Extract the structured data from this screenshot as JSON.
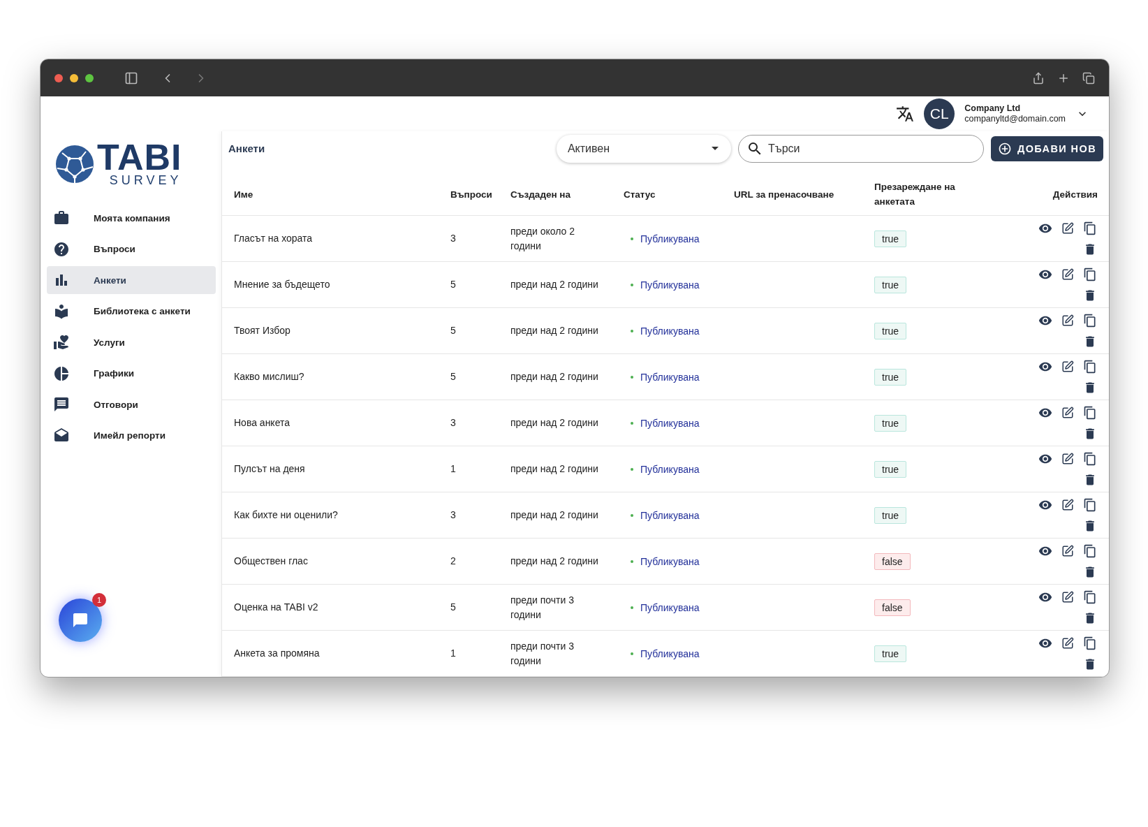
{
  "logo": {
    "title": "TABI",
    "subtitle": "SURVEY"
  },
  "user": {
    "initials": "CL",
    "name": "Company Ltd",
    "email": "companyltd@domain.com"
  },
  "sidebar": {
    "items": [
      {
        "label": "Моята компания",
        "selected": false
      },
      {
        "label": "Въпроси",
        "selected": false
      },
      {
        "label": "Анкети",
        "selected": true
      },
      {
        "label": "Библиотека с анкети",
        "selected": false
      },
      {
        "label": "Услуги",
        "selected": false
      },
      {
        "label": "Графики",
        "selected": false
      },
      {
        "label": "Отговори",
        "selected": false
      },
      {
        "label": "Имейл репорти",
        "selected": false
      }
    ]
  },
  "chat": {
    "badge": "1"
  },
  "page": {
    "title": "Анкети",
    "filter": "Активен",
    "search_placeholder": "Търси",
    "add_button": "ДОБАВИ НОВ"
  },
  "table": {
    "columns": [
      "Име",
      "Въпроси",
      "Създаден на",
      "Статус",
      "URL за пренасочване",
      "Презареждане на анкетата",
      "Действия"
    ],
    "rows": [
      {
        "name": "Гласът на хората",
        "questions": "3",
        "created": "преди около 2 години",
        "status": "Публикувана",
        "reload": {
          "label": "true",
          "kind": "success"
        }
      },
      {
        "name": "Мнение за бъдещето",
        "questions": "5",
        "created": "преди над 2 години",
        "status": "Публикувана",
        "reload": {
          "label": "true",
          "kind": "success"
        }
      },
      {
        "name": "Твоят Избор",
        "questions": "5",
        "created": "преди над 2 години",
        "status": "Публикувана",
        "reload": {
          "label": "true",
          "kind": "success"
        }
      },
      {
        "name": "Какво мислиш?",
        "questions": "5",
        "created": "преди над 2 години",
        "status": "Публикувана",
        "reload": {
          "label": "true",
          "kind": "success"
        }
      },
      {
        "name": "Нова анкета",
        "questions": "3",
        "created": "преди над 2 години",
        "status": "Публикувана",
        "reload": {
          "label": "true",
          "kind": "success"
        }
      },
      {
        "name": "Пулсът на деня",
        "questions": "1",
        "created": "преди над 2 години",
        "status": "Публикувана",
        "reload": {
          "label": "true",
          "kind": "success"
        }
      },
      {
        "name": "Как бихте ни оценили?",
        "questions": "3",
        "created": "преди над 2 години",
        "status": "Публикувана",
        "reload": {
          "label": "true",
          "kind": "success"
        }
      },
      {
        "name": "Обществен глас",
        "questions": "2",
        "created": "преди над 2 години",
        "status": "Публикувана",
        "reload": {
          "label": "false",
          "kind": "error"
        }
      },
      {
        "name": "Оценка на TABI v2",
        "questions": "5",
        "created": "преди почти 3 години",
        "status": "Публикувана",
        "reload": {
          "label": "false",
          "kind": "error"
        }
      },
      {
        "name": "Анкета за промяна",
        "questions": "1",
        "created": "преди почти 3 години",
        "status": "Публикувана",
        "reload": {
          "label": "true",
          "kind": "success"
        }
      }
    ]
  }
}
